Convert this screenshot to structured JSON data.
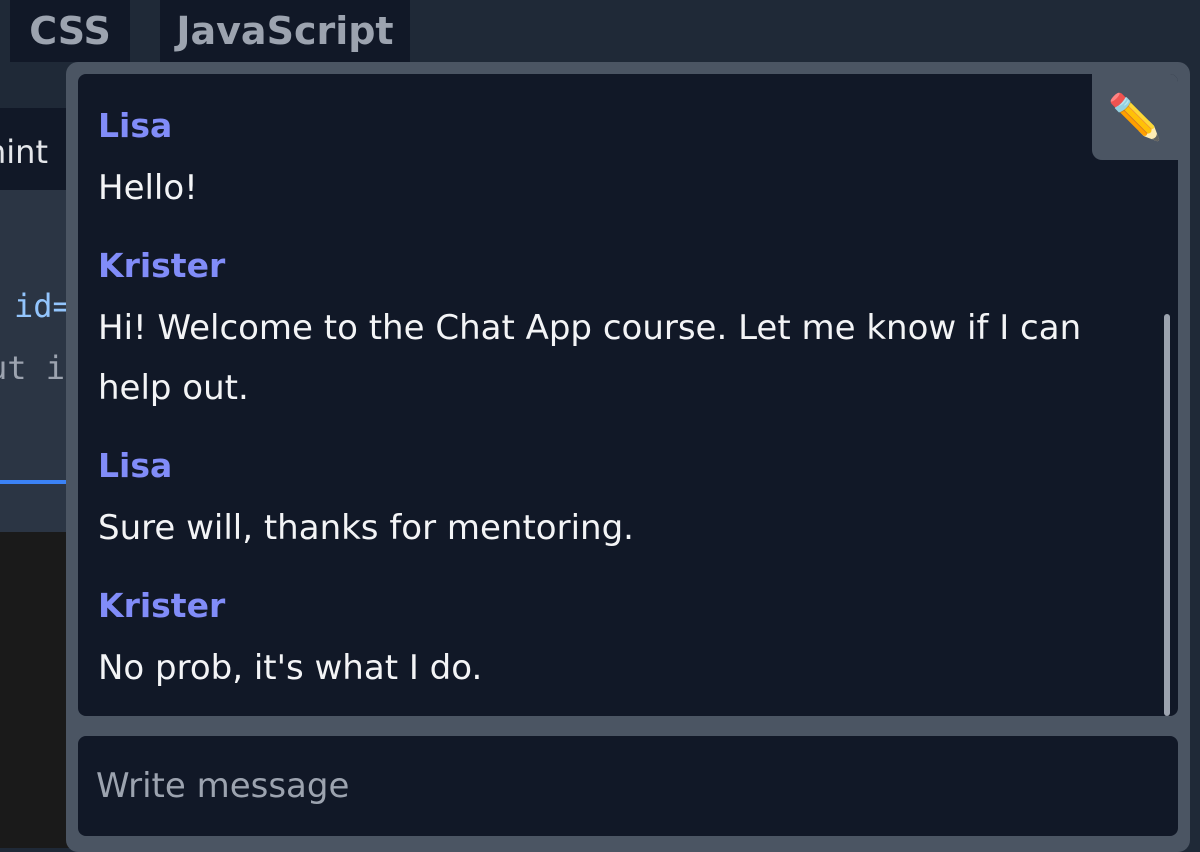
{
  "tabs": [
    {
      "label": "CSS"
    },
    {
      "label": "JavaScript"
    }
  ],
  "editor": {
    "hint_fragment": "hint",
    "code_lines": [
      "id=",
      "ut i"
    ]
  },
  "chat": {
    "edit_icon": "pencil-icon",
    "edit_glyph": "✏️",
    "messages": [
      {
        "author": "Lisa",
        "text": "Hello!"
      },
      {
        "author": "Krister",
        "text": "Hi! Welcome to the Chat App course. Let me know if I can help out."
      },
      {
        "author": "Lisa",
        "text": "Sure will, thanks for mentoring."
      },
      {
        "author": "Krister",
        "text": "No prob, it's what I do."
      }
    ],
    "input": {
      "placeholder": "Write message",
      "value": ""
    }
  },
  "colors": {
    "author_accent": "#818cf8",
    "panel_bg": "#111827",
    "widget_bg": "#4b5563",
    "editor_underline": "#3b82f6"
  }
}
